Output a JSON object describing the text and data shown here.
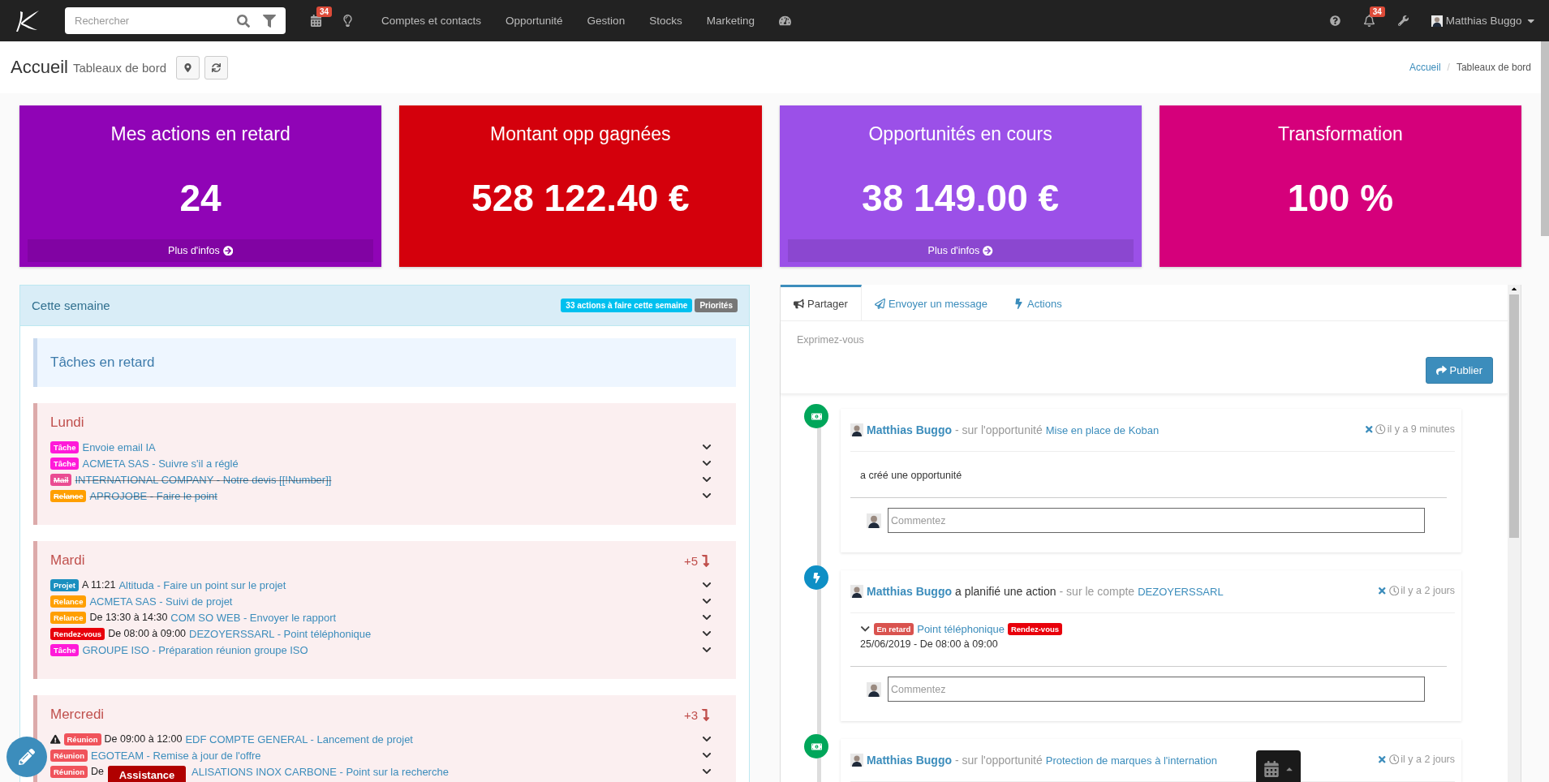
{
  "topbar": {
    "search_placeholder": "Rechercher",
    "calendar_badge": "34",
    "nav": [
      "Comptes et contacts",
      "Opportunité",
      "Gestion",
      "Stocks",
      "Marketing"
    ],
    "notif_badge": "34",
    "user": "Matthias Buggo"
  },
  "header": {
    "title": "Accueil",
    "subtitle": "Tableaux de bord",
    "breadcrumb": [
      {
        "label": "Accueil",
        "link": true
      },
      {
        "label": "Tableaux de bord",
        "link": false
      }
    ],
    "separator": "/"
  },
  "cards": [
    {
      "title": "Mes actions en retard",
      "value": "24",
      "color": "#9004b6",
      "more": "Plus d'infos"
    },
    {
      "title": "Montant opp gagnées",
      "value": "528 122.40 €",
      "color": "#d4000c"
    },
    {
      "title": "Opportunités en cours",
      "value": "38 149.00 €",
      "color": "#9b50e8",
      "more": "Plus d'infos"
    },
    {
      "title": "Transformation",
      "value": "100 %",
      "color": "#d5007b"
    }
  ],
  "week": {
    "title": "Cette semaine",
    "badges": [
      {
        "label": "33 actions à faire cette semaine",
        "color": "#00c0ef"
      },
      {
        "label": "Priorités",
        "color": "#777777"
      }
    ],
    "overdue_title": "Tâches en retard",
    "days": [
      {
        "name": "Lundi",
        "items": [
          {
            "tag": "Tâche",
            "color": "#ff1ad9",
            "text": "Envoie email IA",
            "done": false,
            "warning": false
          },
          {
            "tag": "Tâche",
            "color": "#ff1ad9",
            "text": "ACMETA SAS - Suivre s'il a réglé",
            "done": false,
            "warning": false
          },
          {
            "tag": "Mail",
            "color": "#ea4c92",
            "text": "INTERNATIONAL COMPANY - Notre devis [[!Number]]",
            "done": true,
            "warning": false
          },
          {
            "tag": "Relance",
            "color": "#ff9f00",
            "text": "APROJOBE - Faire le point",
            "done": true,
            "warning": false
          }
        ]
      },
      {
        "name": "Mardi",
        "more": "+5",
        "items": [
          {
            "tag": "Projet",
            "color": "#1a8fbf",
            "time": "A 11:21",
            "text": "Altituda - Faire un point sur le projet",
            "done": false,
            "warning": false
          },
          {
            "tag": "Relance",
            "color": "#ff9f00",
            "text": "ACMETA SAS - Suivi de projet",
            "done": false,
            "warning": false
          },
          {
            "tag": "Relance",
            "color": "#ff9f00",
            "time": "De 13:30 à 14:30",
            "text": "COM SO WEB - Envoyer le rapport",
            "done": false,
            "warning": false
          },
          {
            "tag": "Rendez-vous",
            "color": "#e8000b",
            "time": "De 08:00 à 09:00",
            "text": "DEZOYERSSARL - Point téléphonique",
            "done": false,
            "warning": false
          },
          {
            "tag": "Tâche",
            "color": "#ff1ad9",
            "text": "GROUPE ISO - Préparation réunion groupe ISO",
            "done": false,
            "warning": false
          }
        ]
      },
      {
        "name": "Mercredi",
        "more": "+3",
        "items": [
          {
            "tag": "Réunion",
            "color": "#f0535b",
            "time": "De 09:00 à 12:00",
            "text": "EDF COMPTE GENERAL - Lancement de projet",
            "done": false,
            "warning": true
          },
          {
            "tag": "Réunion",
            "color": "#f0535b",
            "text": "EGOTEAM - Remise à jour de l'offre",
            "done": false,
            "warning": false
          },
          {
            "tag": "Réunion",
            "color": "#f0535b",
            "time": "De",
            "text": "ALISATIONS INOX CARBONE - Point sur la recherche",
            "done": false,
            "warning": false
          }
        ]
      }
    ]
  },
  "feed": {
    "tabs": [
      {
        "label": "Partager",
        "kind": "share",
        "selected": true
      },
      {
        "label": "Envoyer un message",
        "kind": "message",
        "selected": false
      },
      {
        "label": "Actions",
        "kind": "actions",
        "selected": false
      }
    ],
    "placeholder": "Exprimez-vous",
    "publish": "Publier",
    "posts": [
      {
        "kind": "opportunity",
        "author": "Matthias Buggo",
        "context": "- sur l'opportunité",
        "target": "Mise en place de Koban",
        "time": "il y a 9 minutes",
        "body": "a créé une opportunité",
        "comment_placeholder": "Commentez"
      },
      {
        "kind": "action",
        "author": "Matthias Buggo",
        "verb": "a planifié une action",
        "context": "- sur le compte",
        "target": "DEZOYERSSARL",
        "time": "il y a 2 jours",
        "task": {
          "status": "En retard",
          "title": "Point téléphonique",
          "tag": "Rendez-vous",
          "color": "#e8000b",
          "date": "25/06/2019 - De 08:00 à 09:00"
        },
        "comment_placeholder": "Commentez"
      },
      {
        "kind": "opportunity",
        "author": "Matthias Buggo",
        "context": "- sur l'opportunité",
        "target": "Protection de marques à l'internation",
        "time": "il y a 2 jours"
      }
    ]
  },
  "assistance": "Assistance"
}
